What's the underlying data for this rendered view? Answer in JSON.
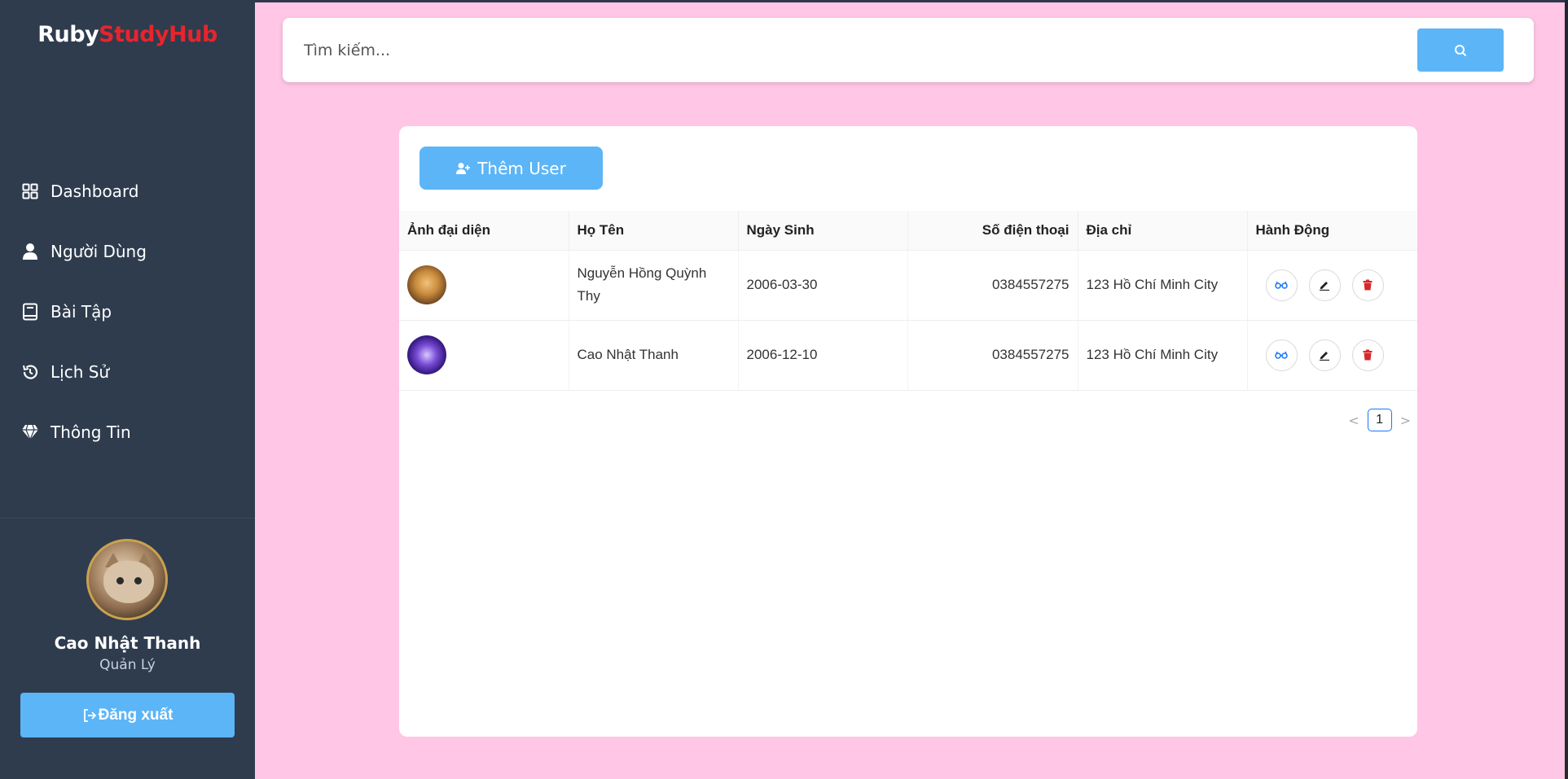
{
  "app": {
    "logo_ruby": "Ruby",
    "logo_hub": "StudyHub"
  },
  "sidebar": {
    "items": [
      {
        "label": "Dashboard",
        "icon": "grid-icon"
      },
      {
        "label": "Người Dùng",
        "icon": "user-icon"
      },
      {
        "label": "Bài Tập",
        "icon": "book-icon"
      },
      {
        "label": "Lịch Sử",
        "icon": "history-icon"
      },
      {
        "label": "Thông Tin",
        "icon": "diamond-icon"
      }
    ],
    "profile": {
      "name": "Cao Nhật Thanh",
      "role": "Quản Lý"
    },
    "logout_label": "Đăng xuất"
  },
  "search": {
    "placeholder": "Tìm kiếm..."
  },
  "main": {
    "add_user_label": "Thêm User",
    "table": {
      "headers": [
        "Ảnh đại diện",
        "Họ Tên",
        "Ngày Sinh",
        "Số điện thoại",
        "Địa chỉ",
        "Hành Động"
      ],
      "rows": [
        {
          "name": "Nguyễn Hồng Quỳnh Thy",
          "dob": "2006-03-30",
          "phone": "0384557275",
          "address": "123 Hồ Chí Minh City"
        },
        {
          "name": "Cao Nhật Thanh",
          "dob": "2006-12-10",
          "phone": "0384557275",
          "address": "123 Hồ Chí Minh City"
        }
      ]
    },
    "pagination": {
      "current": "1",
      "prev": "<",
      "next": ">"
    }
  },
  "colors": {
    "sidebar_bg": "#2e3c4e",
    "page_bg": "#ffc6e5",
    "accent": "#5cb5f7",
    "logo_red": "#e8242c",
    "delete_red": "#d4292e"
  }
}
